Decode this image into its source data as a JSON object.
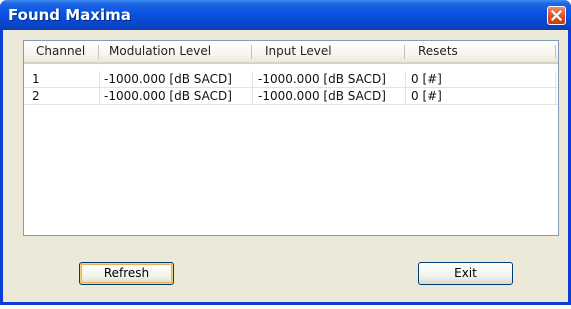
{
  "window": {
    "title": "Found Maxima",
    "close_icon": "close-icon"
  },
  "table": {
    "columns": [
      "Channel",
      "Modulation Level",
      "Input Level",
      "Resets"
    ],
    "rows": [
      [
        "1",
        "-1000.000 [dB SACD]",
        "-1000.000 [dB SACD]",
        "0 [#]"
      ],
      [
        "2",
        "-1000.000 [dB SACD]",
        "-1000.000 [dB SACD]",
        "0 [#]"
      ]
    ]
  },
  "buttons": {
    "refresh_label": "Refresh",
    "exit_label": "Exit"
  },
  "colors": {
    "titlebar": "#0a54e6",
    "close_button": "#e2532a",
    "dialog_background": "#ece9d8"
  }
}
